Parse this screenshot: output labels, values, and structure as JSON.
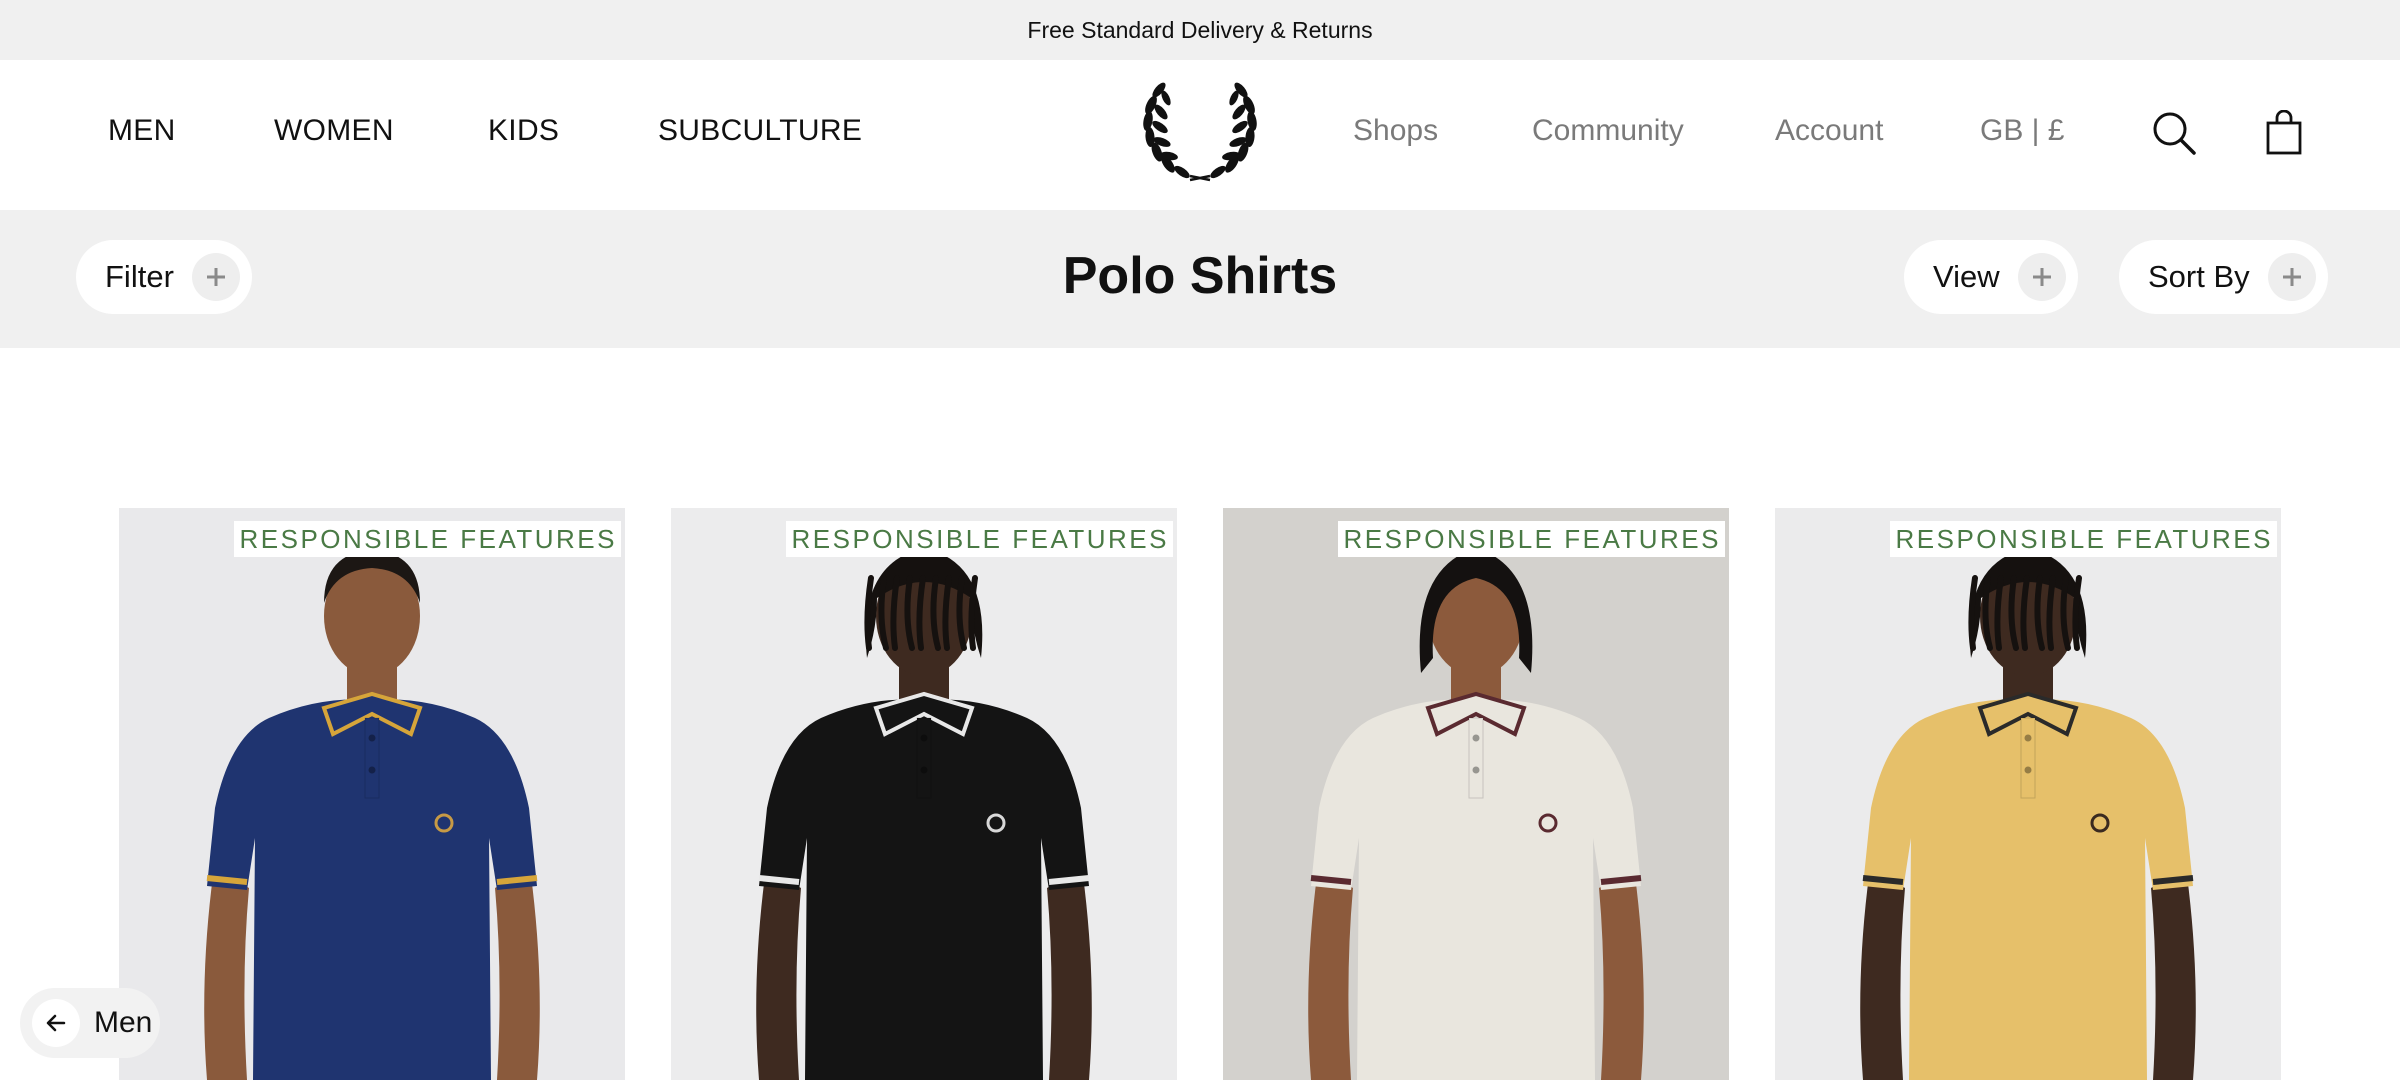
{
  "promo": {
    "text": "Free Standard Delivery & Returns"
  },
  "nav": {
    "primary": [
      "MEN",
      "WOMEN",
      "KIDS",
      "SUBCULTURE"
    ],
    "secondary": [
      "Shops",
      "Community",
      "Account",
      "GB | £"
    ],
    "icons": [
      "laurel-logo-icon",
      "search-icon",
      "shopping-bag-icon"
    ]
  },
  "toolbar": {
    "filter_label": "Filter",
    "title": "Polo Shirts",
    "view_label": "View",
    "sort_label": "Sort By"
  },
  "products": [
    {
      "badge": "RESPONSIBLE FEATURES",
      "shirt_color": "#1f3470",
      "tipping_color": "#d6a53a",
      "logo_color": "#c79a45"
    },
    {
      "badge": "RESPONSIBLE FEATURES",
      "shirt_color": "#141414",
      "tipping_color": "#e8e8e8",
      "logo_color": "#d8d8d8"
    },
    {
      "badge": "RESPONSIBLE FEATURES",
      "shirt_color": "#e9e6de",
      "tipping_color": "#5a2a30",
      "logo_color": "#5a2a30"
    },
    {
      "badge": "RESPONSIBLE FEATURES",
      "shirt_color": "#e6c06a",
      "tipping_color": "#2a2a2a",
      "logo_color": "#3a2a20"
    }
  ],
  "breadcrumb_back": {
    "label": "Men"
  },
  "colors": {
    "badge_text": "#4a7a45",
    "toolbar_bg": "#f0f0f0",
    "secondary_nav": "#7a7a7a"
  }
}
